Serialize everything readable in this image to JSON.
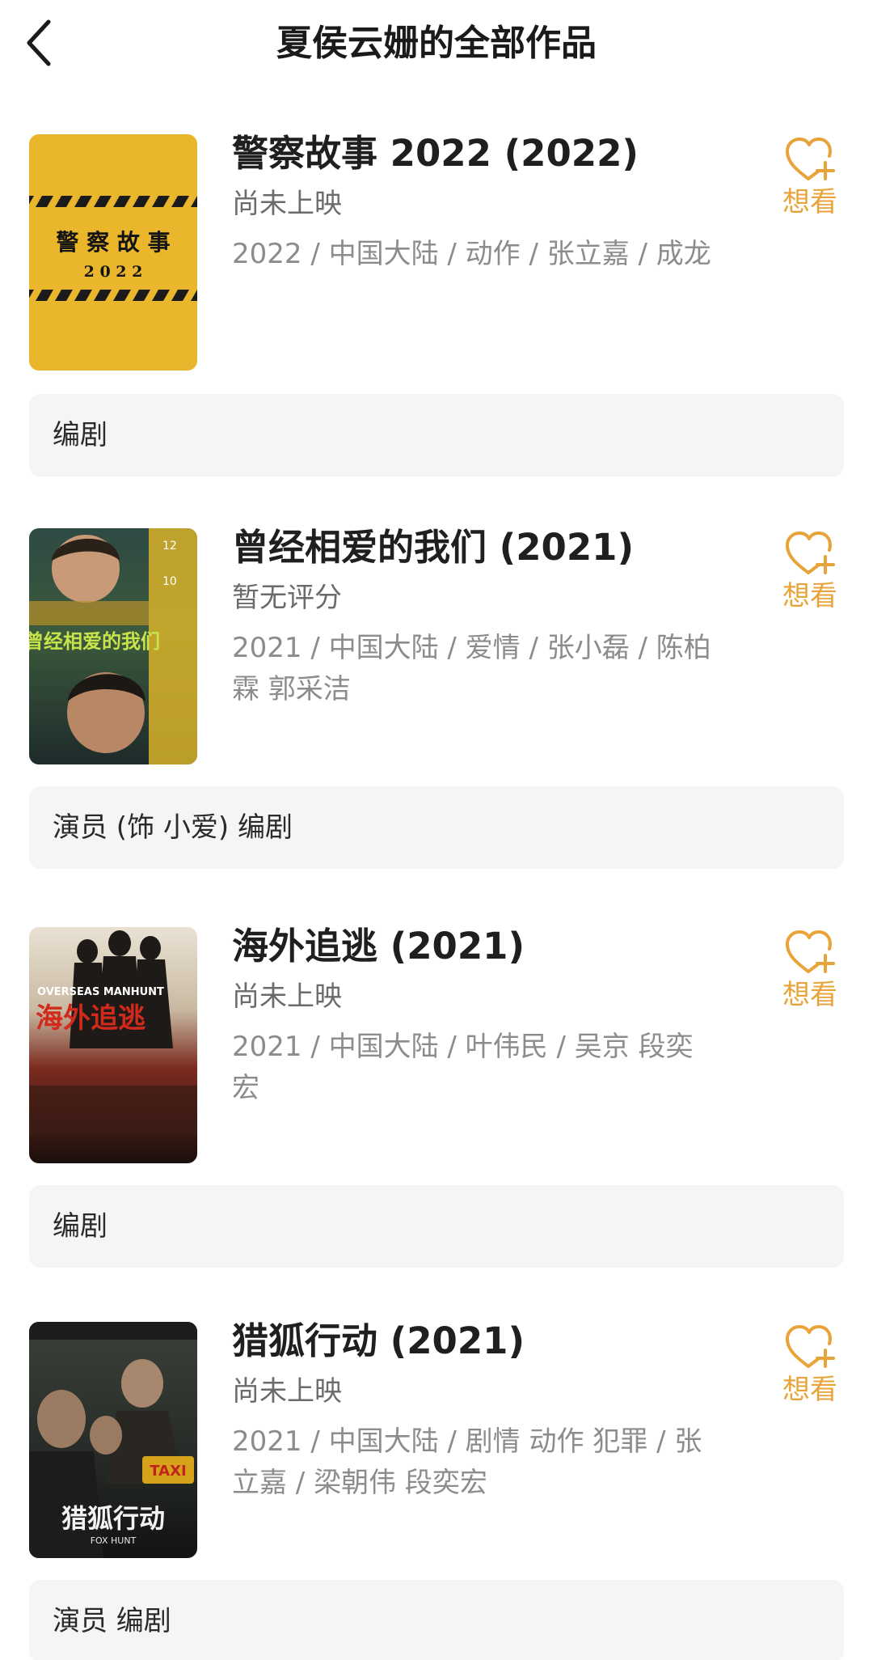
{
  "header": {
    "title": "夏侯云姗的全部作品"
  },
  "accent_color": "#e8a43a",
  "movies": [
    {
      "title": "警察故事 2022 (2022)",
      "rating": "尚未上映",
      "meta": "2022 / 中国大陆 / 动作 / 张立嘉 / 成龙",
      "want_label": "想看",
      "role": "编剧",
      "poster_text": [
        "警 察 故 事",
        "2 0 2 2"
      ]
    },
    {
      "title": "曾经相爱的我们 (2021)",
      "rating": "暂无评分",
      "meta": "2021 / 中国大陆 / 爱情 / 张小磊 / 陈柏霖 郭采洁",
      "want_label": "想看",
      "role": "演员 (饰 小爱) 编剧",
      "poster_text": [
        "曾经相爱的我们"
      ]
    },
    {
      "title": "海外追逃 (2021)",
      "rating": "尚未上映",
      "meta": "2021 / 中国大陆 / 叶伟民 / 吴京 段奕宏",
      "want_label": "想看",
      "role": "编剧",
      "poster_text": [
        "海外追逃",
        "OVERSEAS MANHUNT"
      ]
    },
    {
      "title": "猎狐行动 (2021)",
      "rating": "尚未上映",
      "meta": "2021 / 中国大陆 / 剧情 动作 犯罪 / 张立嘉 / 梁朝伟 段奕宏",
      "want_label": "想看",
      "role": "演员 编剧",
      "poster_text": [
        "猎狐行动",
        "FOX HUNT"
      ]
    }
  ]
}
